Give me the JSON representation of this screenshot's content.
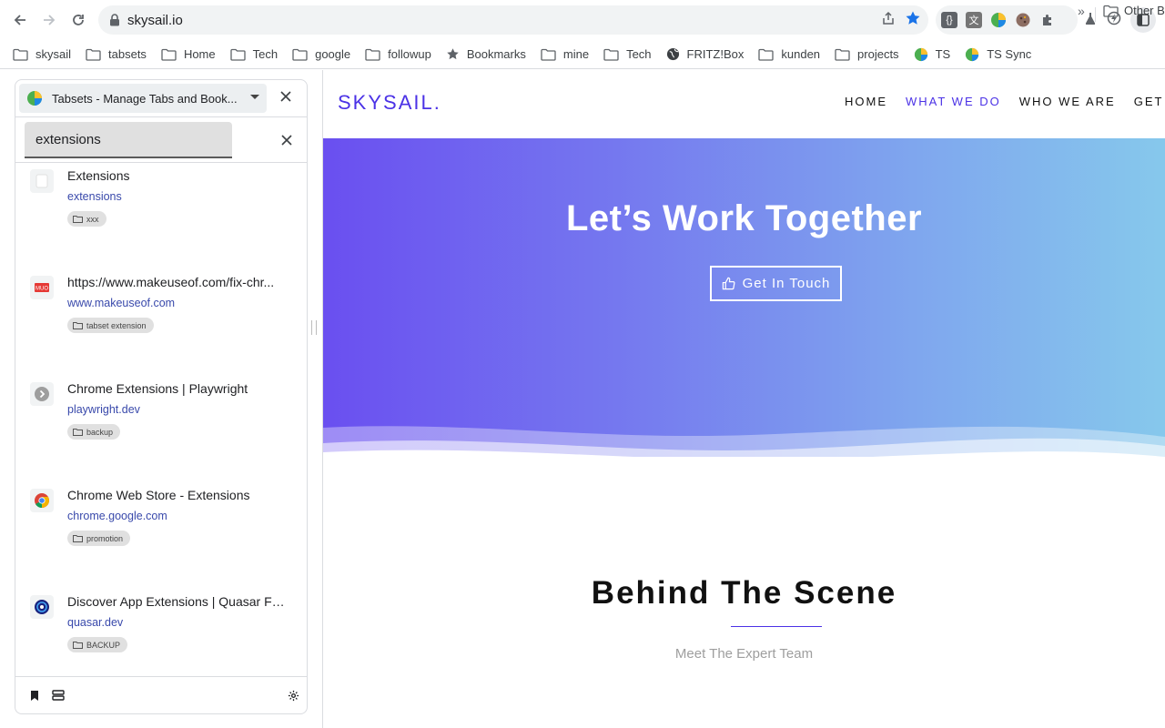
{
  "browser": {
    "url": "skysail.io",
    "colors": {
      "accent": "#1a73e8",
      "omnibox_bg": "#f1f3f4"
    }
  },
  "bookmarks": {
    "items": [
      {
        "label": "skysail",
        "icon": "folder-icon"
      },
      {
        "label": "tabsets",
        "icon": "folder-icon"
      },
      {
        "label": "Home",
        "icon": "folder-icon"
      },
      {
        "label": "Tech",
        "icon": "folder-icon"
      },
      {
        "label": "google",
        "icon": "folder-icon"
      },
      {
        "label": "followup",
        "icon": "folder-icon"
      },
      {
        "label": "Bookmarks",
        "icon": "star-icon"
      },
      {
        "label": "mine",
        "icon": "folder-icon"
      },
      {
        "label": "Tech",
        "icon": "folder-icon"
      },
      {
        "label": "FRITZ!Box",
        "icon": "globe-icon"
      },
      {
        "label": "kunden",
        "icon": "folder-icon"
      },
      {
        "label": "projects",
        "icon": "folder-icon"
      },
      {
        "label": "TS",
        "icon": "tabsets-icon"
      },
      {
        "label": "TS Sync",
        "icon": "tabsets-icon"
      }
    ],
    "more": "»",
    "other": "Other B"
  },
  "sidepanel": {
    "title": "Tabsets - Manage Tabs and Book...",
    "search": {
      "value": "extensions"
    },
    "results": [
      {
        "title": "Extensions",
        "url": "extensions",
        "tag": "xxx"
      },
      {
        "title": "https://www.makeuseof.com/fix-chr...",
        "url": "www.makeuseof.com",
        "tag": "tabset extension"
      },
      {
        "title": "Chrome Extensions | Playwright",
        "url": "playwright.dev",
        "tag": "backup"
      },
      {
        "title": "Chrome Web Store - Extensions",
        "url": "chrome.google.com",
        "tag": "promotion"
      },
      {
        "title": "Discover App Extensions | Quasar Fr...",
        "url": "quasar.dev",
        "tag": "BACKUP"
      }
    ]
  },
  "site": {
    "logo": "SKYSAIL.",
    "nav": {
      "home": "HOME",
      "what": "WHAT WE DO",
      "who": "WHO WE ARE",
      "get": "GET IN"
    },
    "hero": {
      "title": "Let’s Work Together",
      "button": "Get In Touch"
    },
    "section": {
      "title": "Behind The Scene",
      "subtitle": "Meet The Expert Team"
    },
    "colors": {
      "brand": "#4b32e6",
      "gradient_start": "#6a4ff0",
      "gradient_end": "#86c8ec"
    }
  }
}
